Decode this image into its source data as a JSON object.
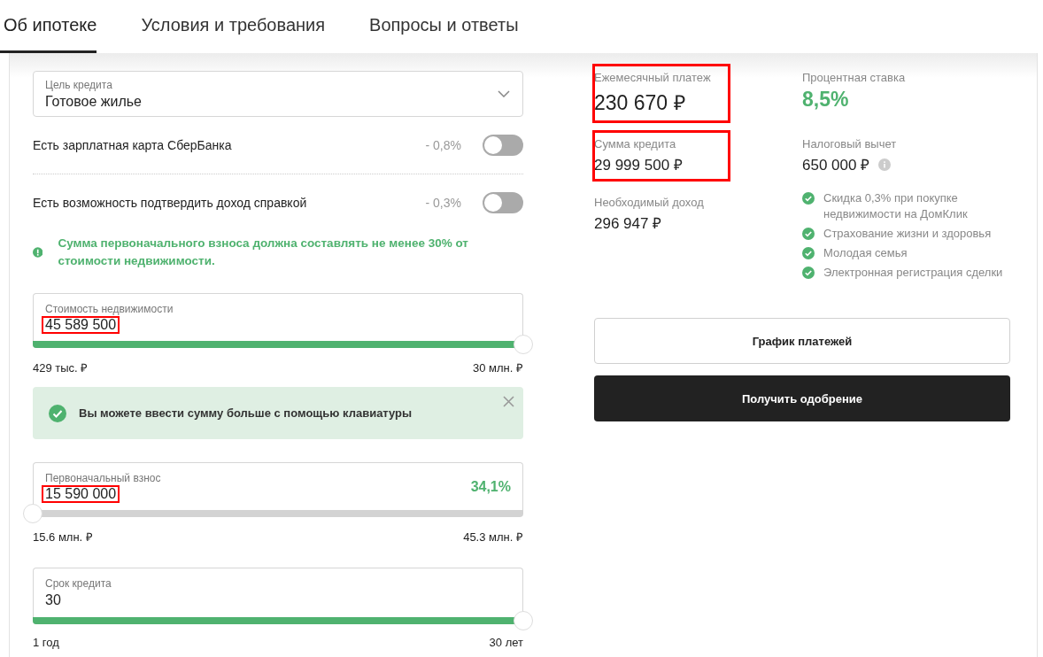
{
  "tabs": [
    {
      "label": "Об ипотеке",
      "selected": true
    },
    {
      "label": "Условия и требования",
      "selected": false
    },
    {
      "label": "Вопросы и ответы",
      "selected": false
    }
  ],
  "purpose": {
    "label": "Цель кредита",
    "value": "Готовое жилье"
  },
  "toggles": [
    {
      "label": "Есть зарплатная карта СберБанка",
      "discount": "- 0,8%",
      "on": false
    },
    {
      "label": "Есть возможность подтвердить доход справкой",
      "discount": "- 0,3%",
      "on": false
    }
  ],
  "warning": "Сумма первоначального взноса должна составлять не менее 30% от стоимости недвижимости.",
  "sliders": [
    {
      "label": "Стоимость недвижимости",
      "value": "45 589 500",
      "highlighted": true,
      "level": 1,
      "min": "429 тыс. ₽",
      "max": "30 млн. ₽"
    },
    {
      "label": "Первоначальный взнос",
      "value": "15 590 000",
      "highlighted": true,
      "percent": "34,1%",
      "level": 0,
      "min": "15.6 млн. ₽",
      "max": "45.3 млн. ₽"
    },
    {
      "label": "Срок кредита",
      "value": "30",
      "highlighted": false,
      "level": 1,
      "min": "1 год",
      "max": "30 лет"
    }
  ],
  "notice": {
    "text": "Вы можете ввести сумму больше с помощью клавиатуры"
  },
  "results": [
    {
      "label": "Ежемесячный платеж",
      "value": "230 670 ₽",
      "kind": "large",
      "highlighted": true
    },
    {
      "label": "Процентная ставка",
      "value": "8,5%",
      "kind": "accent",
      "highlighted": false
    },
    {
      "label": "Сумма кредита",
      "value": "29 999 500 ₽",
      "kind": "normal",
      "highlighted": true
    },
    {
      "label": "Налоговый вычет",
      "value": "650 000 ₽",
      "kind": "info",
      "highlighted": false
    },
    {
      "label": "Необходимый доход",
      "value": "296 947 ₽",
      "kind": "normal",
      "highlighted": false
    },
    {
      "kind": "benefits",
      "items": [
        "Скидка 0,3% при покупке недвижимости на ДомКлик",
        "Страхование жизни и здоровья",
        "Молодая семья",
        "Электронная регистрация сделки"
      ]
    }
  ],
  "buttons": [
    {
      "label": "График платежей",
      "kind": "outline"
    },
    {
      "label": "Получить одобрение",
      "kind": "primary"
    }
  ]
}
